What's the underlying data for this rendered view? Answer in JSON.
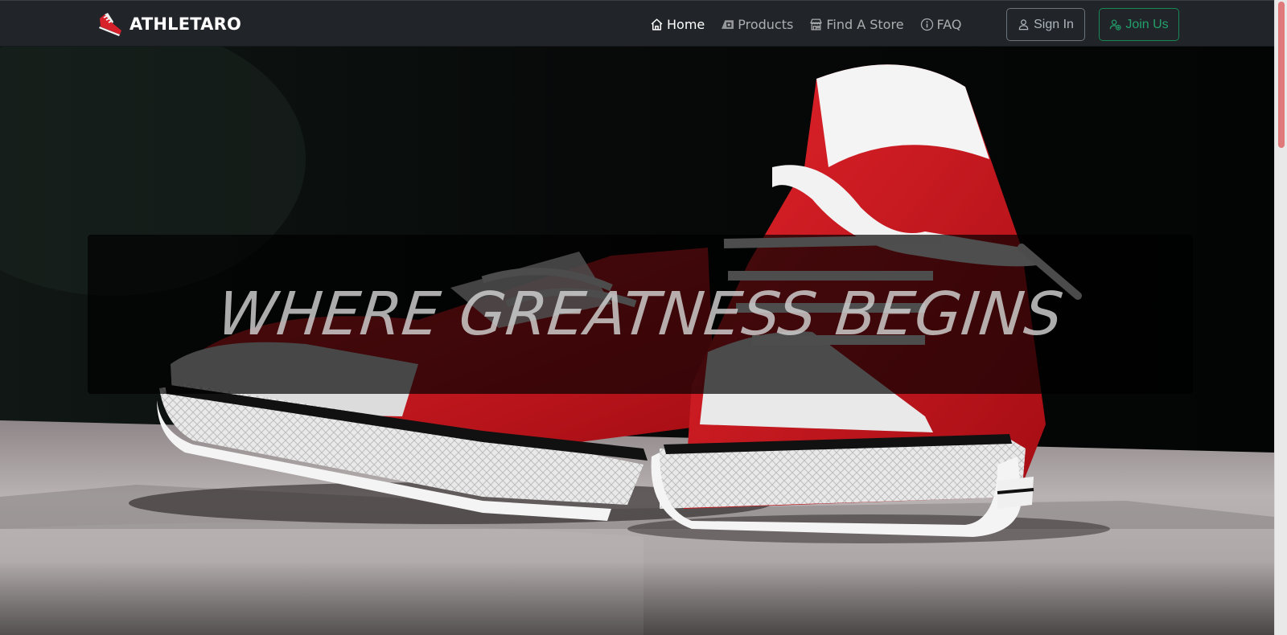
{
  "brand": {
    "name": "ATHLETARO",
    "logo_icon": "sneaker-icon"
  },
  "nav": {
    "items": [
      {
        "label": "Home",
        "icon": "home-icon",
        "active": true
      },
      {
        "label": "Products",
        "icon": "products-icon",
        "active": false
      },
      {
        "label": "Find A Store",
        "icon": "store-icon",
        "active": false
      },
      {
        "label": "FAQ",
        "icon": "info-icon",
        "active": false
      }
    ]
  },
  "auth": {
    "signin_label": "Sign In",
    "signin_icon": "person-icon",
    "join_label": "Join Us",
    "join_icon": "person-add-icon"
  },
  "hero": {
    "tagline": "WHERE GREATNESS BEGINS",
    "image_subject": "red canvas sneakers"
  },
  "colors": {
    "navbar_bg": "#212529",
    "join_accent": "#198754",
    "signin_border": "#6c757d",
    "sneaker_red": "#c8121a"
  }
}
